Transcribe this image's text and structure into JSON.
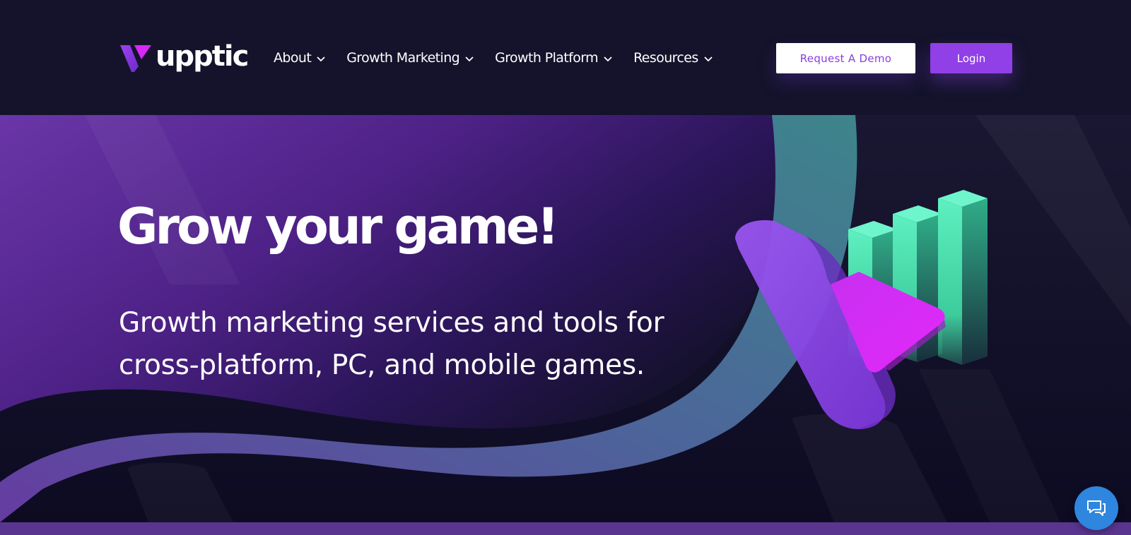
{
  "header": {
    "logo_text": "upptic",
    "nav": [
      {
        "label": "About",
        "icon": "chevron-down-icon"
      },
      {
        "label": "Growth Marketing",
        "icon": "chevron-down-icon"
      },
      {
        "label": "Growth Platform",
        "icon": "chevron-down-icon"
      },
      {
        "label": "Resources",
        "icon": "chevron-down-icon"
      }
    ],
    "demo_button": "Request A Demo",
    "login_button": "Login"
  },
  "hero": {
    "title": "Grow your game!",
    "subtitle": "Growth marketing services and tools for cross-platform, PC, and mobile games."
  },
  "chat": {
    "icon": "chat-bubbles-icon"
  },
  "colors": {
    "header_bg": "#14132b",
    "accent_purple": "#9040e6",
    "hero_purple": "#5b2a9a",
    "teal": "#4fd8b0",
    "chat_blue": "#2e86de"
  }
}
